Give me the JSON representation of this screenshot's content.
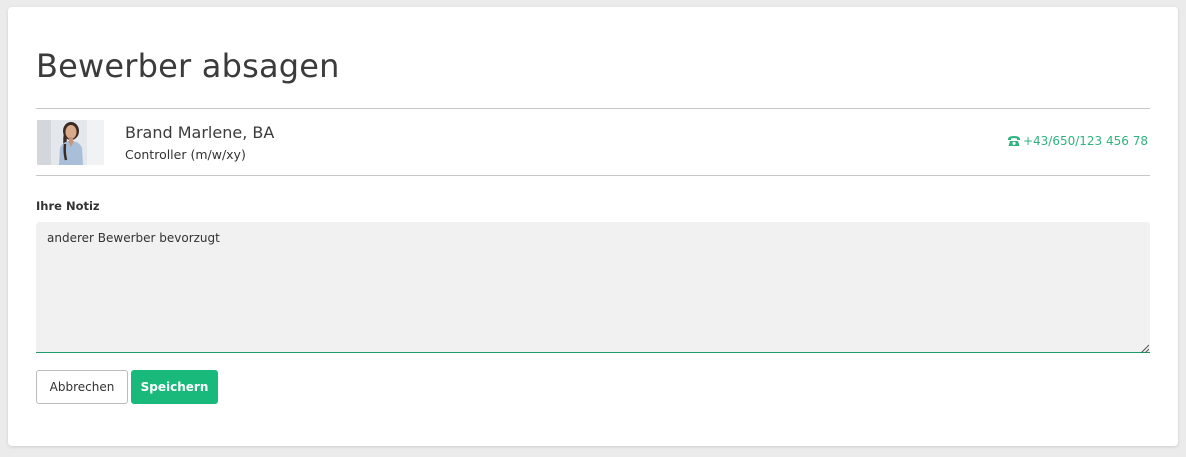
{
  "dialog": {
    "title": "Bewerber absagen"
  },
  "candidate": {
    "name": "Brand Marlene, BA",
    "position": "Controller (m/w/xy)",
    "phone": "+43/650/123 456 78",
    "phone_icon": "phone-icon",
    "accent_color": "#2fb37f"
  },
  "note": {
    "label": "Ihre Notiz",
    "value": "anderer Bewerber bevorzugt"
  },
  "actions": {
    "cancel_label": "Abbrechen",
    "save_label": "Speichern",
    "save_color": "#19b97c"
  }
}
